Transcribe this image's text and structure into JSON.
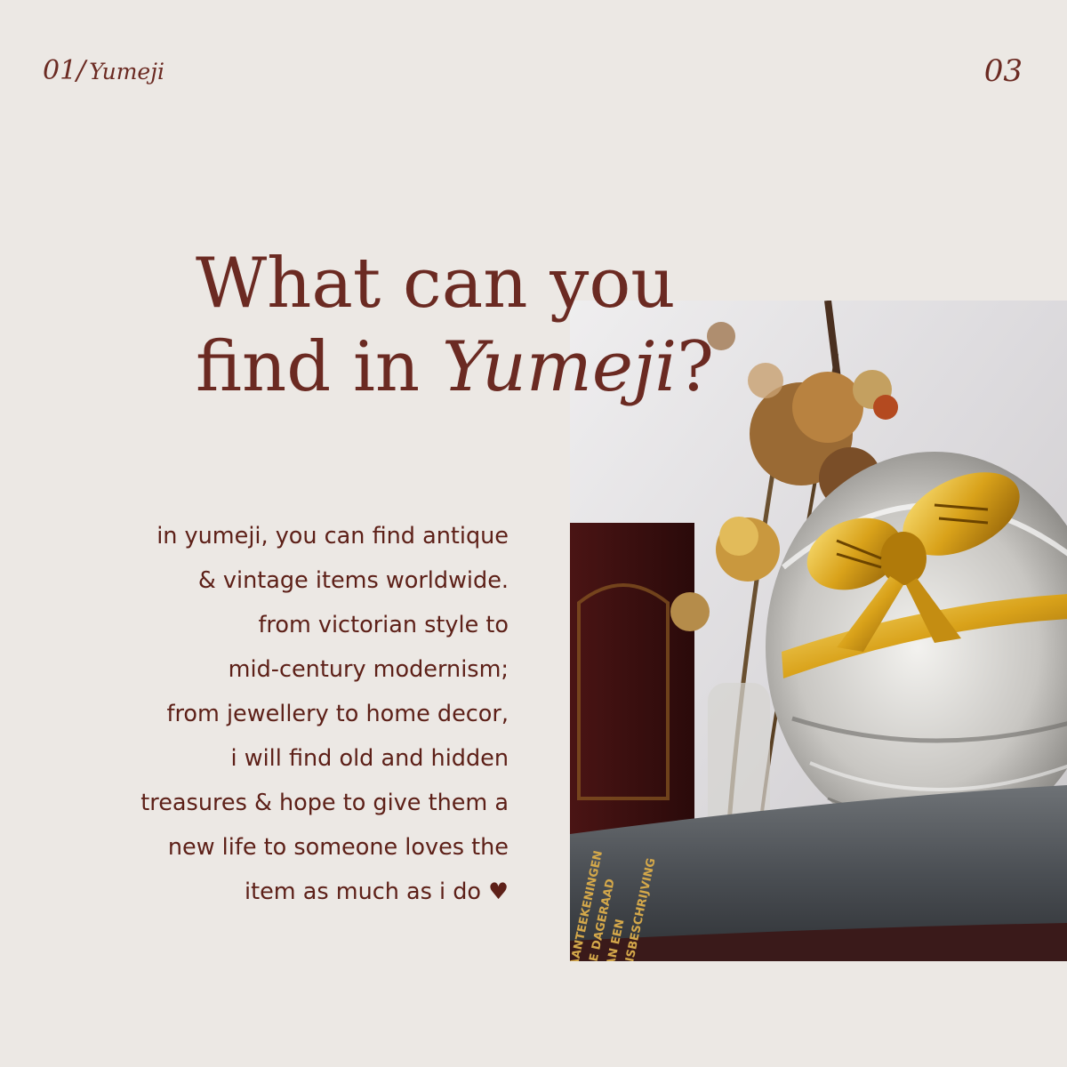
{
  "header": {
    "number": "01/",
    "brand": "Yumeji",
    "page": "03"
  },
  "headline": {
    "line1": "What can you",
    "line2_start": "find in ",
    "line2_italic": "Yumeji",
    "line2_end": "?"
  },
  "body": {
    "lines": [
      "in yumeji, you can find antique",
      "& vintage items worldwide.",
      "from victorian style to",
      "mid-century modernism;",
      "from jewellery to home decor,",
      "i will find old and hidden",
      "treasures & hope to give them a",
      "new life to someone loves the",
      "item as much as i do ♥"
    ]
  },
  "photo": {
    "book_spine_text": [
      "AANTEEKENINGEN",
      "DE DAGERAAD",
      "VAN EEN",
      "REISBESCHRIJVING"
    ]
  },
  "colors": {
    "background": "#ece8e4",
    "accent": "#6b2a22",
    "body_text": "#5d2018"
  }
}
